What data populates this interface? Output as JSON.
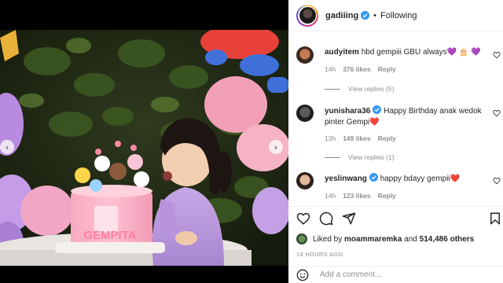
{
  "post": {
    "username": "gadiiing",
    "follow_status": "Following",
    "separator": "•",
    "colors": {
      "verified": "#3897f0",
      "heart": "#ed4956",
      "text": "#262626",
      "muted": "#8e8e8e"
    }
  },
  "photo": {
    "cake_text": "GEMPITA",
    "description_icon": "birthday-photo"
  },
  "comments": [
    {
      "username": "audyitem",
      "verified": false,
      "text": "hbd gempiii GBU always💜 🎂 💜",
      "time": "14h",
      "likes": "376 likes",
      "reply_label": "Reply",
      "view_replies": "View replies (5)"
    },
    {
      "username": "yunishara36",
      "verified": true,
      "text": "Happy Birthday anak wedok pinter Gempi❤️",
      "time": "13h",
      "likes": "149 likes",
      "reply_label": "Reply",
      "view_replies": "View replies (1)"
    },
    {
      "username": "yeslinwang",
      "verified": true,
      "text": "happy bdayy gempii❤️",
      "time": "14h",
      "likes": "123 likes",
      "reply_label": "Reply"
    }
  ],
  "engagement": {
    "liked_prefix": "Liked by",
    "liked_user": "moammaremka",
    "liked_and": "and",
    "liked_count": "514,486 others",
    "timestamp": "14 HOURS AGO"
  },
  "composer": {
    "placeholder": "Add a comment..."
  },
  "icons": {
    "like": "heart-icon",
    "comment": "comment-icon",
    "share": "share-icon",
    "save": "bookmark-icon",
    "emoji": "emoji-icon",
    "prev": "chevron-left-icon",
    "next": "chevron-right-icon"
  }
}
